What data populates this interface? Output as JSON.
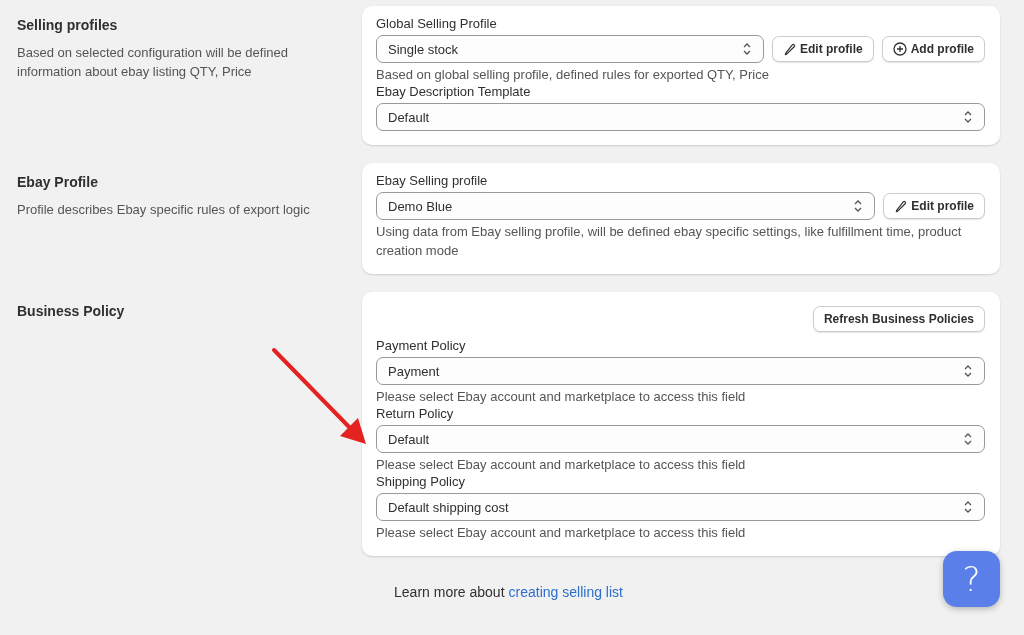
{
  "sections": [
    {
      "title": "Selling profiles",
      "description": "Based on selected configuration will be defined information about ebay listing QTY, Price",
      "fields": [
        {
          "label": "Global Selling Profile",
          "value": "Single stock",
          "buttons": [
            {
              "label": "Edit profile",
              "kind": "edit"
            },
            {
              "label": "Add profile",
              "kind": "add"
            }
          ],
          "help": "Based on global selling profile, defined rules for exported QTY, Price"
        },
        {
          "label": "Ebay Description Template",
          "value": "Default"
        }
      ]
    },
    {
      "title": "Ebay Profile",
      "description": "Profile describes Ebay specific rules of export logic",
      "fields": [
        {
          "label": "Ebay Selling profile",
          "value": "Demo Blue",
          "buttons": [
            {
              "label": "Edit profile",
              "kind": "edit"
            }
          ],
          "help": "Using data from Ebay selling profile, will be defined ebay specific settings, like fulfillment time, product creation mode"
        }
      ]
    },
    {
      "title": "Business Policy",
      "header_buttons": [
        "Refresh Business Policies"
      ],
      "fields": [
        {
          "label": "Payment Policy",
          "value": "Payment",
          "help": "Please select Ebay account and marketplace to access this field"
        },
        {
          "label": "Return Policy",
          "value": "Default",
          "help": "Please select Ebay account and marketplace to access this field"
        },
        {
          "label": "Shipping Policy",
          "value": "Default shipping cost",
          "help": "Please select Ebay account and marketplace to access this field"
        }
      ]
    }
  ],
  "footer": {
    "text": "Learn more about",
    "link": "creating selling list"
  },
  "help_button": {
    "label": "?"
  }
}
